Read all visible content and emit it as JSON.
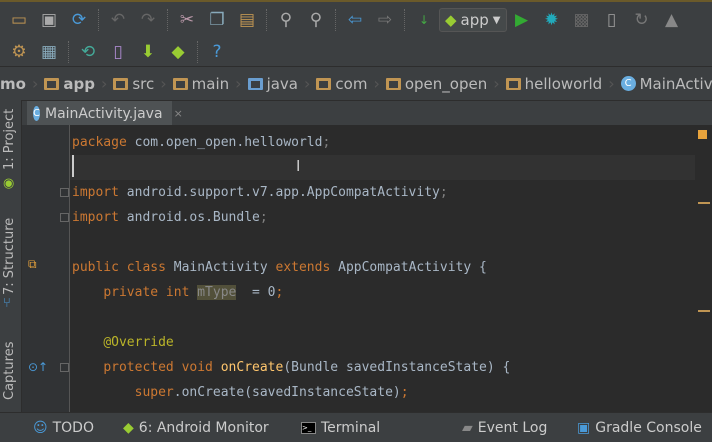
{
  "toolbar": {
    "run_config": "app"
  },
  "breadcrumb": [
    "mo",
    "app",
    "src",
    "main",
    "java",
    "com",
    "open_open",
    "helloworld",
    "MainActivit"
  ],
  "tab": {
    "label": "MainActivity.java",
    "close": "×",
    "icon_letter": "C"
  },
  "left_panel": {
    "project": "1: Project",
    "structure": "7: Structure",
    "captures": "Captures"
  },
  "code": [
    [
      [
        "kw",
        "package"
      ],
      [
        "",
        "com.open_open.helloworld"
      ],
      [
        "gr",
        ";"
      ]
    ],
    [],
    [
      [
        "kw",
        "import"
      ],
      [
        "",
        "android.support.v7.app.AppCompatActivity"
      ],
      [
        "gr",
        ";"
      ]
    ],
    [
      [
        "kw",
        "import"
      ],
      [
        "",
        "android.os.Bundle"
      ],
      [
        "gr",
        ";"
      ]
    ],
    [],
    [
      [
        "kw",
        "public class"
      ],
      [
        "",
        " MainActivity "
      ],
      [
        "kw",
        "extends"
      ],
      [
        "",
        " AppCompatActivity {"
      ]
    ],
    [
      [
        "",
        "    "
      ],
      [
        "kw",
        "private int "
      ],
      [
        "hl",
        "mType"
      ],
      [
        "",
        " "
      ],
      [
        "",
        " = 0"
      ],
      [
        "kw",
        ";"
      ]
    ],
    [],
    [
      [
        "",
        "    "
      ],
      [
        "an",
        "@Override"
      ]
    ],
    [
      [
        "",
        "    "
      ],
      [
        "kw",
        "protected void "
      ],
      [
        "fn",
        "onCreate"
      ],
      [
        "",
        "(Bundle savedInstanceState) {"
      ]
    ],
    [
      [
        "",
        "        "
      ],
      [
        "kw",
        "super"
      ],
      [
        "",
        ".onCreate(savedInstanceState)"
      ],
      [
        "kw",
        ";"
      ]
    ]
  ],
  "bottom": {
    "todo": "TODO",
    "monitor": "6: Android Monitor",
    "terminal": "Terminal",
    "event_log": "Event Log",
    "gradle": "Gradle Console"
  }
}
